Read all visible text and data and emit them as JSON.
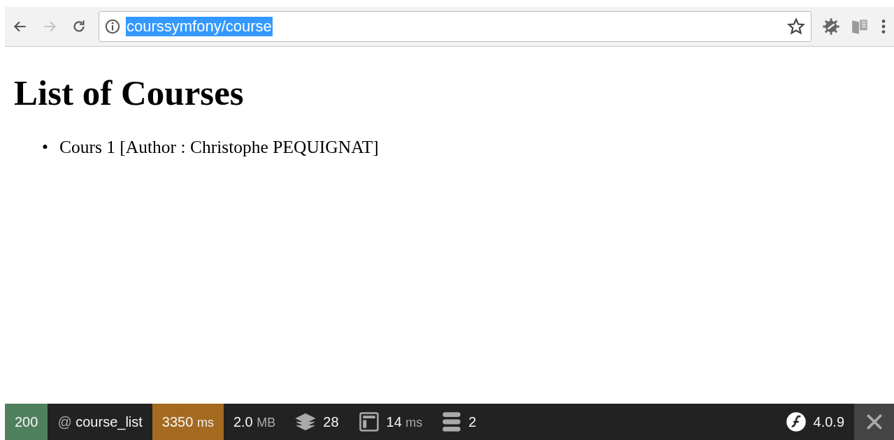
{
  "browser": {
    "nav": [
      {
        "kind": "back",
        "disabled": false
      },
      {
        "kind": "forward",
        "disabled": true
      },
      {
        "kind": "reload",
        "disabled": false
      }
    ],
    "url": {
      "value": "courssymfony/course",
      "selected": true
    }
  },
  "page": {
    "title": "List of Courses",
    "items": [
      {
        "bullet": "•",
        "text": "Cours 1 [Author : Christophe PEQUIGNAT]"
      }
    ]
  },
  "debug_bar": {
    "items": [
      {
        "kind": "status",
        "value": "200"
      },
      {
        "kind": "route",
        "prefix": "@",
        "value": "course_list"
      },
      {
        "kind": "time",
        "value": "3350",
        "unit": "ms"
      },
      {
        "kind": "memory",
        "value": "2.0",
        "unit": "MB"
      },
      {
        "kind": "forms",
        "value": "28"
      },
      {
        "kind": "twig",
        "value": "14",
        "unit": "ms"
      },
      {
        "kind": "db",
        "value": "2"
      }
    ],
    "version": "4.0.9"
  }
}
